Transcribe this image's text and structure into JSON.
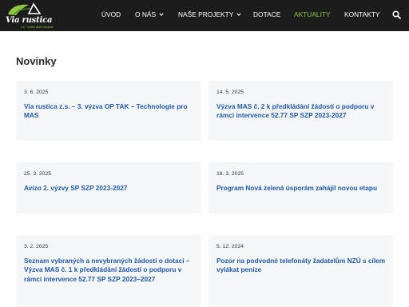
{
  "header": {
    "logo": {
      "name": "Via rustica",
      "tagline": "z.s. · místní akční skupina"
    },
    "nav": [
      {
        "label": "ÚVOD"
      },
      {
        "label": "O NÁS"
      },
      {
        "label": "NAŠE PROJEKTY"
      },
      {
        "label": "DOTACE"
      },
      {
        "label": "AKTUALITY"
      },
      {
        "label": "KONTAKTY"
      }
    ],
    "active": "AKTUALITY"
  },
  "main": {
    "title": "Novinky",
    "posts": [
      {
        "date": "3. 6. 2025",
        "title": "Via rustica z.s. – 3. výzva OP TAK – Technologie pro MAS"
      },
      {
        "date": "14. 5. 2025",
        "title": "Výzva MAS č. 2 k předkládání žádostí o podporu v rámci intervence 52.77 SP SZP 2023-2027"
      },
      {
        "date": "25. 3. 2025",
        "title": "Avízo 2. výzvy SP SZP 2023-2027"
      },
      {
        "date": "18. 3. 2025",
        "title": "Program Nová zelená úsporám zahájil novou etapu"
      },
      {
        "date": "3. 2. 2025",
        "title": "Seznam vybraných a nevybraných žádostí o dotaci – Výzva MAS č. 1 k předkládání žádostí o podporu v rámci intervence 52.77 SP SZP 2023–2027"
      },
      {
        "date": "5. 12. 2024",
        "title": "Pozor na podvodné telefonáty žadatelům NZÚ s cílem vylákat peníze"
      }
    ]
  },
  "colors": {
    "header_bg": "#1c1c1c",
    "accent": "#8dc63f",
    "link": "#1e5aa8",
    "card_bg": "#f5f6f7"
  },
  "icons": {
    "search": "search-icon",
    "dropdown": "chevron-down-icon"
  }
}
